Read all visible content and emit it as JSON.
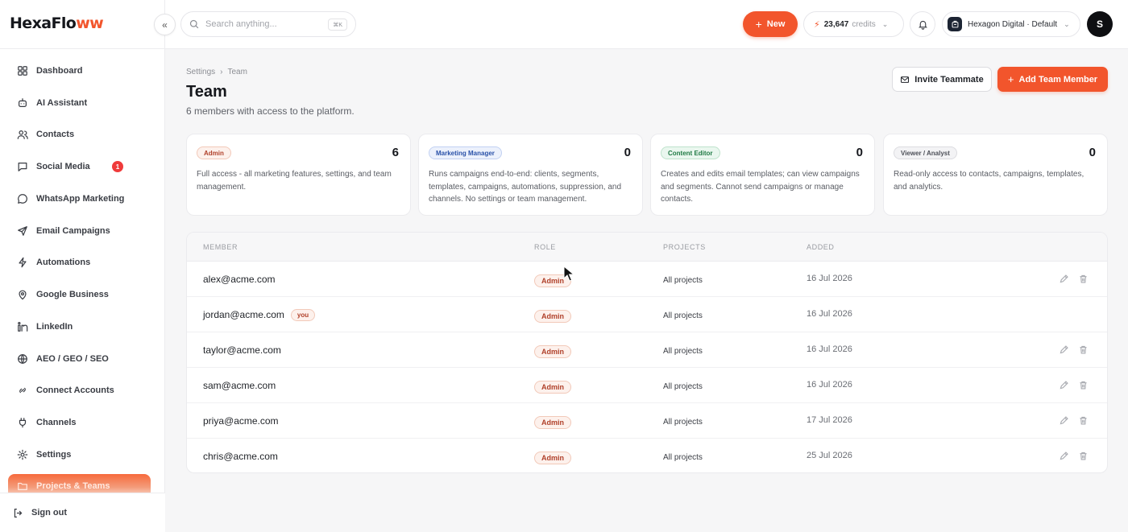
{
  "brand": {
    "logo_main": "HexaFlo",
    "logo_accent": "ww",
    "accent_color": "#f2552c"
  },
  "sidebar": {
    "items": [
      {
        "label": "Dashboard",
        "icon": "dashboard-icon"
      },
      {
        "label": "AI Assistant",
        "icon": "robot-icon"
      },
      {
        "label": "Contacts",
        "icon": "users-icon"
      },
      {
        "label": "Social Media",
        "icon": "chat-icon",
        "badge": "1"
      },
      {
        "label": "WhatsApp Marketing",
        "icon": "whatsapp-icon"
      },
      {
        "label": "Email Campaigns",
        "icon": "send-icon"
      },
      {
        "label": "Automations",
        "icon": "bolt-icon"
      },
      {
        "label": "Google Business",
        "icon": "map-pin-icon"
      },
      {
        "label": "LinkedIn",
        "icon": "linkedin-icon"
      },
      {
        "label": "AEO / GEO / SEO",
        "icon": "globe-icon"
      },
      {
        "label": "Connect Accounts",
        "icon": "link-icon"
      },
      {
        "label": "Channels",
        "icon": "plug-icon"
      },
      {
        "label": "Settings",
        "icon": "gear-icon"
      },
      {
        "label": "Projects & Teams",
        "icon": "folder-icon",
        "active": true
      }
    ],
    "signout_label": "Sign out"
  },
  "header": {
    "search_placeholder": "Search anything...",
    "search_shortcut": "⌘K",
    "new_label": "New",
    "credits_value": "23,647",
    "credits_label": "credits",
    "workspace_label": "Hexagon Digital · Default",
    "avatar_initial": "S"
  },
  "page": {
    "breadcrumb_parent": "Settings",
    "breadcrumb_current": "Team",
    "title": "Team",
    "subtitle": "6 members with access to the platform.",
    "invite_label": "Invite Teammate",
    "add_label": "Add Team Member"
  },
  "roles": [
    {
      "name": "Admin",
      "count": "6",
      "desc": "Full access - all marketing features, settings, and team management.",
      "style": "admin"
    },
    {
      "name": "Marketing Manager",
      "count": "0",
      "desc": "Runs campaigns end-to-end: clients, segments, templates, campaigns, automations, suppression, and channels. No settings or team management.",
      "style": "mm"
    },
    {
      "name": "Content Editor",
      "count": "0",
      "desc": "Creates and edits email templates; can view campaigns and segments. Cannot send campaigns or manage contacts.",
      "style": "ce"
    },
    {
      "name": "Viewer / Analyst",
      "count": "0",
      "desc": "Read-only access to contacts, campaigns, templates, and analytics.",
      "style": "va"
    }
  ],
  "table": {
    "columns": [
      "MEMBER",
      "ROLE",
      "PROJECTS",
      "ADDED"
    ],
    "rows": [
      {
        "email": "alex@acme.com",
        "role": "Admin",
        "projects": "All projects",
        "added": "16 Jul 2026",
        "you": false,
        "actions": true
      },
      {
        "email": "jordan@acme.com",
        "role": "Admin",
        "projects": "All projects",
        "added": "16 Jul 2026",
        "you": true,
        "you_label": "you",
        "actions": false
      },
      {
        "email": "taylor@acme.com",
        "role": "Admin",
        "projects": "All projects",
        "added": "16 Jul 2026",
        "you": false,
        "actions": true
      },
      {
        "email": "sam@acme.com",
        "role": "Admin",
        "projects": "All projects",
        "added": "16 Jul 2026",
        "you": false,
        "actions": true
      },
      {
        "email": "priya@acme.com",
        "role": "Admin",
        "projects": "All projects",
        "added": "17 Jul 2026",
        "you": false,
        "actions": true
      },
      {
        "email": "chris@acme.com",
        "role": "Admin",
        "projects": "All projects",
        "added": "25 Jul 2026",
        "you": false,
        "actions": true
      }
    ]
  }
}
